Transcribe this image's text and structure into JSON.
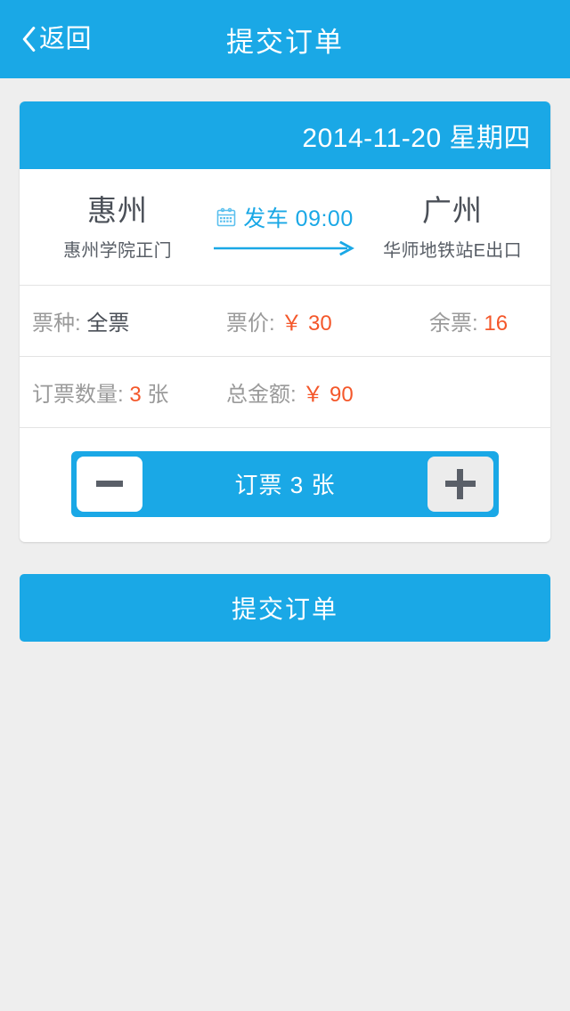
{
  "header": {
    "back_label": "返回",
    "title": "提交订单",
    "back_icon": "chevron-left-icon"
  },
  "order_card": {
    "date": "2014-11-20 星期四",
    "route": {
      "origin_city": "惠州",
      "origin_station": "惠州学院正门",
      "destination_city": "广州",
      "destination_station": "华师地铁站E出口",
      "depart_text": "发车 09:00",
      "calendar_icon": "calendar-icon",
      "arrow_icon": "arrow-right-icon"
    },
    "ticket_info": {
      "type_label": "票种:",
      "type_value": "全票",
      "price_label": "票价:",
      "price_value": "￥ 30",
      "remaining_label": "余票:",
      "remaining_value": "16"
    },
    "order_info": {
      "quantity_label": "订票数量:",
      "quantity_value": "3",
      "quantity_unit": "张",
      "total_label": "总金额:",
      "total_value": "￥ 90"
    },
    "stepper": {
      "decrease_icon": "minus-icon",
      "increase_icon": "plus-icon",
      "label": "订票 3 张"
    }
  },
  "submit": {
    "label": "提交订单"
  },
  "colors": {
    "brand_blue": "#1aa8e6",
    "accent_orange": "#f4572a",
    "page_background": "#eeeeee",
    "text_dark": "#4a4f57",
    "text_muted": "#9a9a9a"
  }
}
